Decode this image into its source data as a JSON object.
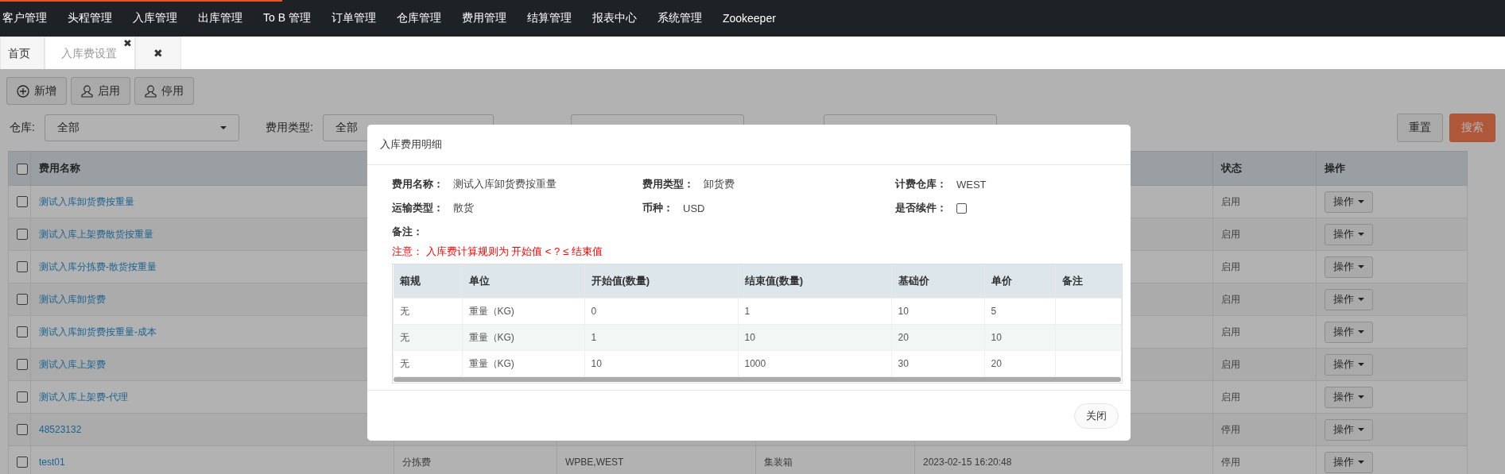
{
  "nav": {
    "items": [
      "客户管理",
      "头程管理",
      "入库管理",
      "出库管理",
      "To B 管理",
      "订单管理",
      "仓库管理",
      "费用管理",
      "结算管理",
      "报表中心",
      "系统管理",
      "Zookeeper"
    ]
  },
  "tabs": [
    {
      "label": "首页",
      "selected": false
    },
    {
      "label": "入库费设置",
      "selected": true,
      "close": "✖"
    },
    {
      "label": "✖",
      "selected": false
    }
  ],
  "toolbar": [
    {
      "label": "新增",
      "kind": "add"
    },
    {
      "label": "启用",
      "kind": "user"
    },
    {
      "label": "停用",
      "kind": "user"
    }
  ],
  "filters": {
    "warehouse": {
      "label": "仓库:",
      "value": "全部"
    },
    "fee_type": {
      "label": "费用类型:",
      "value": "全部"
    },
    "reset": "重置",
    "search": "搜索"
  },
  "table": {
    "header_checked": false,
    "columns": [
      "费用名称",
      "",
      "",
      "",
      "",
      "状态",
      "操作"
    ],
    "rows": [
      {
        "checked": false,
        "name": "测试入库卸货费按重量",
        "cells": [],
        "status": "启用",
        "action": "操作"
      },
      {
        "checked": false,
        "name": "测试入库上架费散货按重量",
        "cells": [],
        "status": "启用",
        "action": "操作"
      },
      {
        "checked": false,
        "name": "测试入库分拣费-散货按重量",
        "cells": [],
        "status": "启用",
        "action": "操作"
      },
      {
        "checked": false,
        "name": "测试入库卸货费",
        "cells": [],
        "status": "启用",
        "action": "操作"
      },
      {
        "checked": false,
        "name": "测试入库卸货费按重量-成本",
        "cells": [],
        "status": "启用",
        "action": "操作"
      },
      {
        "checked": false,
        "name": "测试入库上架费",
        "cells": [],
        "status": "启用",
        "action": "操作"
      },
      {
        "checked": false,
        "name": "测试入库上架费-代理",
        "cells": [],
        "status": "启用",
        "action": "操作"
      },
      {
        "checked": false,
        "name": "48523132",
        "cells": [],
        "status": "停用",
        "action": "操作"
      },
      {
        "checked": false,
        "name": "test01",
        "cells": [
          "分拣费",
          "WPBE,WEST",
          "集装箱",
          "2023-02-15 16:20:48"
        ],
        "status": "停用",
        "action": "操作"
      }
    ]
  },
  "modal": {
    "title": "入库费用明细",
    "fields": [
      {
        "label": "费用名称：",
        "kind": "text",
        "value": "测试入库卸货费按重量"
      },
      {
        "label": "费用类型：",
        "kind": "text",
        "value": "卸货费"
      },
      {
        "label": "计费仓库：",
        "kind": "text",
        "value": "WEST"
      },
      {
        "label": "运输类型：",
        "kind": "text",
        "value": "散货"
      },
      {
        "label": "币种：",
        "kind": "text",
        "value": "USD"
      },
      {
        "label": "是否续件：",
        "kind": "checkbox",
        "checked": false
      },
      {
        "label": "备注：",
        "kind": "text"
      }
    ],
    "note": "注意： 入库费计算规则为 开始值 < ? ≤ 结束值",
    "columns": [
      "箱规",
      "单位",
      "开始值(数量)",
      "结束值(数量)",
      "基础价",
      "单价",
      "备注"
    ],
    "rows": [
      [
        "无",
        "重量（KG)",
        "0",
        "1",
        "10",
        "5",
        ""
      ],
      [
        "无",
        "重量（KG)",
        "1",
        "10",
        "20",
        "10",
        ""
      ],
      [
        "无",
        "重量（KG)",
        "10",
        "1000",
        "30",
        "20",
        ""
      ]
    ],
    "close": "关闭"
  }
}
